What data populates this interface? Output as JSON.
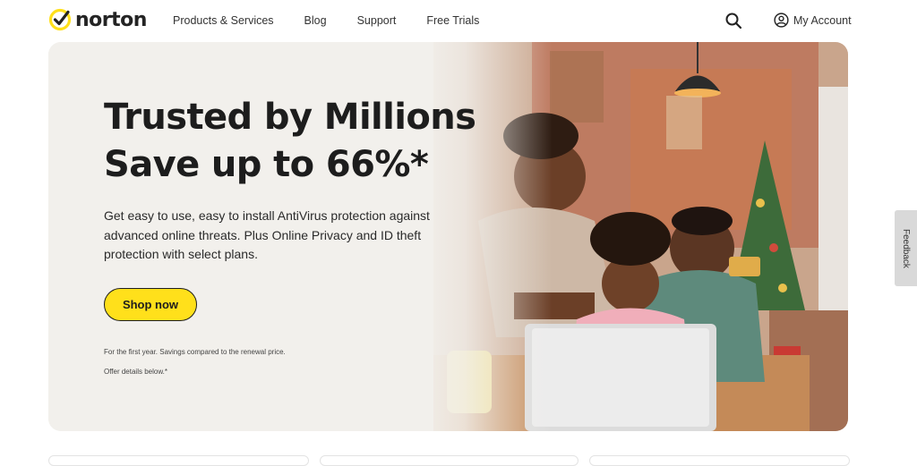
{
  "brand": {
    "name": "norton",
    "accent": "#ffe01b",
    "check_color": "#222222"
  },
  "nav": {
    "items": [
      {
        "label": "Products & Services"
      },
      {
        "label": "Blog"
      },
      {
        "label": "Support"
      },
      {
        "label": "Free Trials"
      }
    ]
  },
  "header": {
    "search_icon": "search-icon",
    "account_icon": "user-circle-icon",
    "account_label": "My Account"
  },
  "hero": {
    "title_line1": "Trusted by Millions",
    "title_line2": "Save up to 66%*",
    "description": "Get easy to use, easy to install AntiVirus protection against advanced online threats. Plus Online Privacy and ID theft protection with select plans.",
    "cta_label": "Shop now",
    "fine_print_1": "For the first year. Savings compared to the renewal price.",
    "fine_print_2": "Offer details below.*",
    "button_color": "#ffe01b",
    "background": "#f1efeb"
  },
  "feedback": {
    "label": "Feedback"
  }
}
